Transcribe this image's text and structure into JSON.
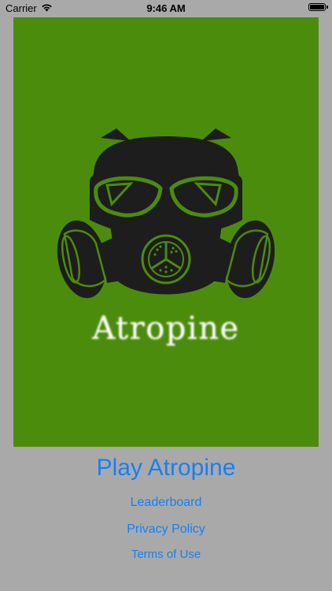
{
  "status_bar": {
    "carrier": "Carrier",
    "time": "9:46 AM",
    "wifi_icon": "wifi-icon",
    "battery_icon": "battery-icon",
    "battery_level": 1.0
  },
  "splash": {
    "background": "#4c8c0d",
    "logo_icon": "gas-mask-icon",
    "logo_text": "Atropine"
  },
  "menu": {
    "play_label": "Play Atropine",
    "leaderboard_label": "Leaderboard",
    "privacy_label": "Privacy Policy",
    "terms_label": "Terms of Use",
    "link_color": "#1580f5"
  }
}
